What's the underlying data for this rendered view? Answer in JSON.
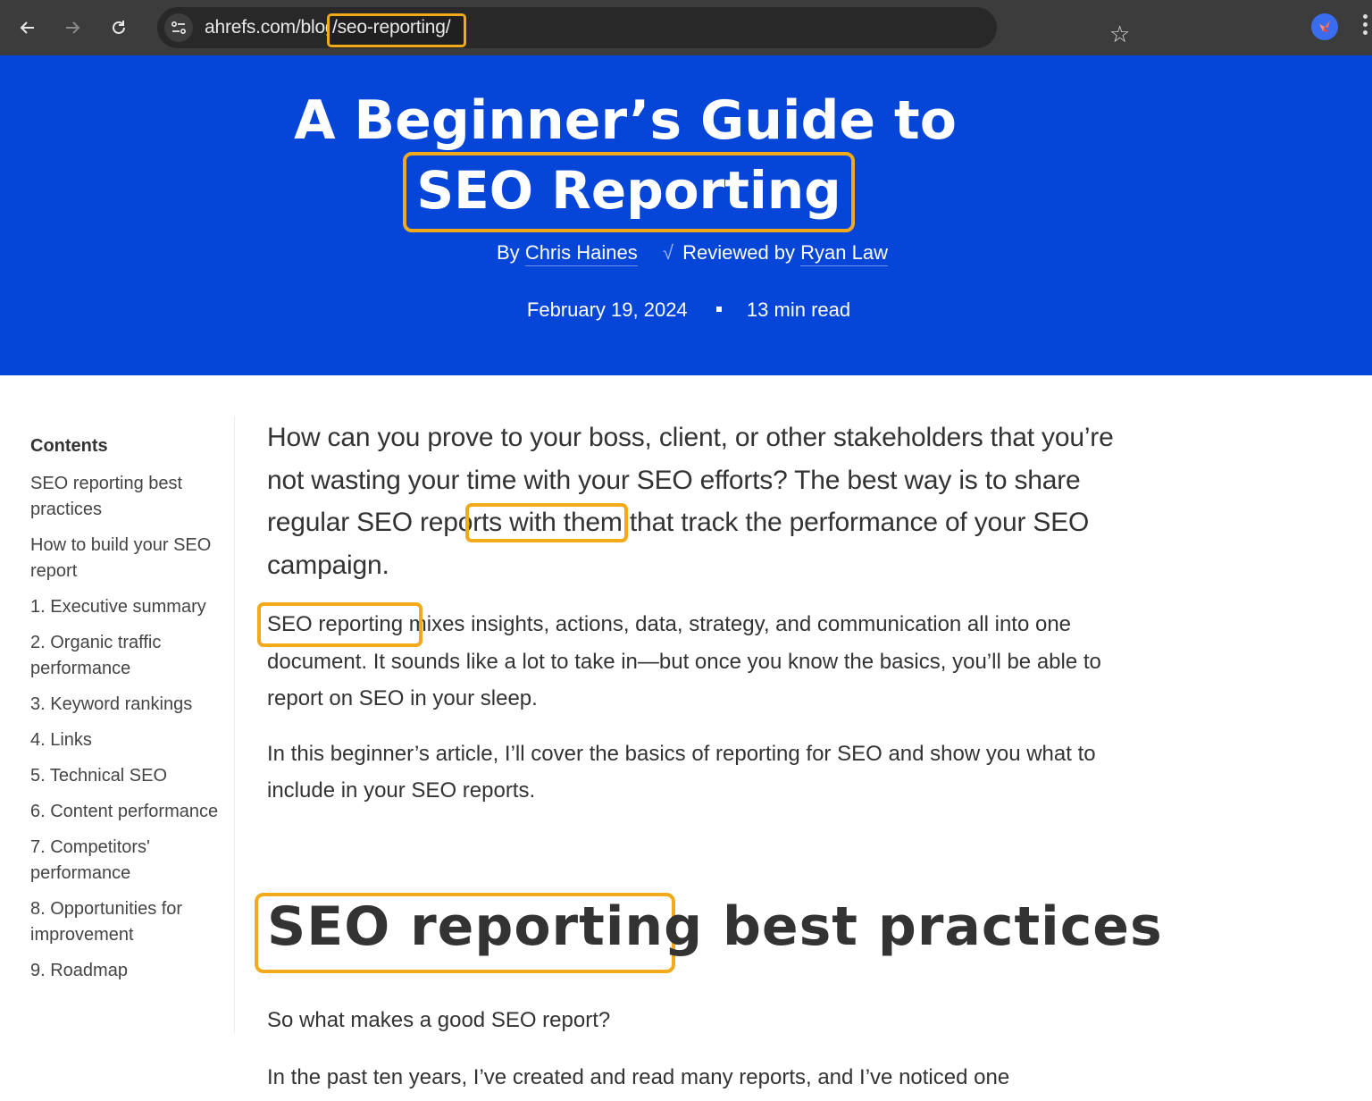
{
  "browser": {
    "url_host": "ahrefs.com/blog",
    "url_path": "/seo-reporting/",
    "icons": {
      "back": "arrow-left-icon",
      "forward": "arrow-right-icon",
      "reload": "reload-icon",
      "site_info": "tune-icon",
      "bookmark": "star-icon",
      "extension": "butterfly-extension-icon",
      "menu": "vertical-dots-icon"
    }
  },
  "hero": {
    "title_line1": "A Beginner’s Guide to",
    "title_line2": "SEO Reporting",
    "by_prefix": "By",
    "author": "Chris Haines",
    "reviewed_prefix": "Reviewed by",
    "reviewer": "Ryan Law",
    "check_glyph": "√",
    "date": "February 19, 2024",
    "read_time": "13 min read",
    "background_color": "#0546d8"
  },
  "toc": {
    "title": "Contents",
    "items": [
      "SEO reporting best practices",
      "How to build your SEO report",
      "1. Executive summary",
      "2. Organic traffic performance",
      "3. Keyword rankings",
      "4. Links",
      "5. Technical SEO",
      "6. Content performance",
      "7. Competitors' performance",
      "8. Opportunities for improvement",
      "9. Roadmap"
    ]
  },
  "article": {
    "lead_before": "How can you prove to your boss, client, or other stakeholders that you’re not wasting your time with your SEO efforts? The best way is to share regular ",
    "lead_link": "SEO reports",
    "lead_after": " with them that track the performance of your SEO campaign.",
    "p1_link": "SEO reporting",
    "p1_after": " mixes insights, actions, data, strategy, and communication all into one document. It sounds like a lot to take in—but once you know the basics, you’ll be able to report on SEO in your sleep.",
    "p2": "In this beginner’s article, I’ll cover the basics of reporting for SEO and show you what to include in your SEO reports.",
    "h2_highlight": "SEO reporting",
    "h2_rest": " best practices",
    "p3": "So what makes a good SEO report?",
    "p4": "In the past ten years, I’ve created and read many reports, and I’ve noticed one"
  },
  "highlight_color": "#f2a91a"
}
